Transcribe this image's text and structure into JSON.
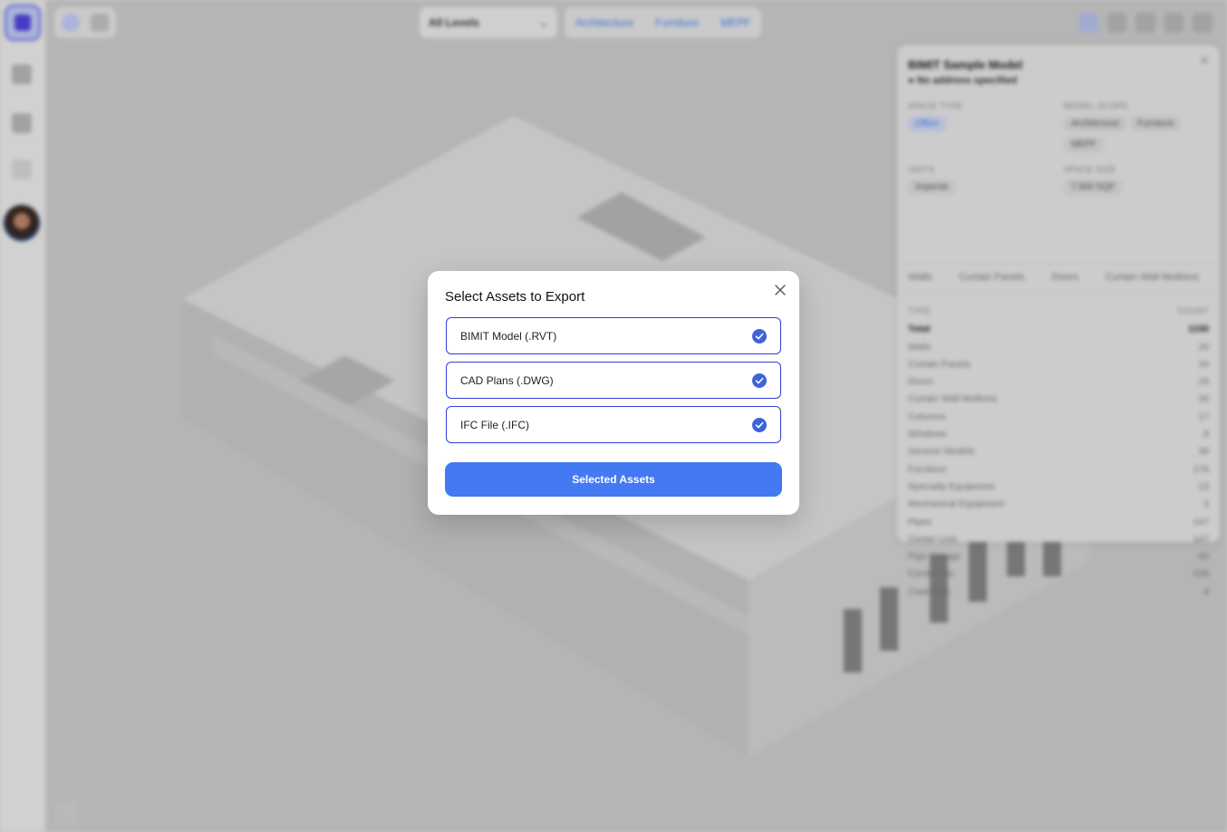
{
  "dialog": {
    "title": "Select Assets to Export",
    "options": [
      {
        "label": "BIMIT Model (.RVT)",
        "checked": true
      },
      {
        "label": "CAD Plans (.DWG)",
        "checked": true
      },
      {
        "label": "IFC File (.IFC)",
        "checked": true
      }
    ],
    "submit_label": "Selected Assets"
  },
  "toolbar": {
    "levels_select": "All Levels",
    "filters": [
      "Architecture",
      "Furniture",
      "MEPF"
    ]
  },
  "panel": {
    "title": "BIMIT Sample Model",
    "address": "No address specified",
    "space_type_label": "SPACE TYPE",
    "space_type_value": "Office",
    "model_scope_label": "MODEL SCOPE",
    "model_scope_values": [
      "Architecture",
      "Furniture",
      "MEPF"
    ],
    "units_label": "UNITS",
    "units_value": "Imperial",
    "space_size_label": "SPACE SIZE",
    "space_size_value": "7,500 SQF",
    "tabs": [
      "Walls",
      "Curtain Panels",
      "Doors",
      "Curtain Wall Mullions"
    ],
    "table_header": {
      "type": "TYPE",
      "count": "COUNT"
    },
    "rows": [
      {
        "type": "Total",
        "count": "1150"
      },
      {
        "type": "Walls",
        "count": "26"
      },
      {
        "type": "Curtain Panels",
        "count": "24"
      },
      {
        "type": "Doors",
        "count": "18"
      },
      {
        "type": "Curtain Wall Mullions",
        "count": "26"
      },
      {
        "type": "Columns",
        "count": "17"
      },
      {
        "type": "Windows",
        "count": "8"
      },
      {
        "type": "Generic Models",
        "count": "39"
      },
      {
        "type": "Furniture",
        "count": "176"
      },
      {
        "type": "Specialty Equipment",
        "count": "13"
      },
      {
        "type": "Mechanical Equipment",
        "count": "3"
      },
      {
        "type": "Pipes",
        "count": "147"
      },
      {
        "type": "Center Line",
        "count": "147"
      },
      {
        "type": "Pipe Fittings",
        "count": "93"
      },
      {
        "type": "Center line",
        "count": "159"
      },
      {
        "type": "Casework",
        "count": "4"
      }
    ]
  },
  "colors": {
    "accent": "#4479f4",
    "option_border": "#2e3fd6",
    "check": "#3f63d9"
  }
}
